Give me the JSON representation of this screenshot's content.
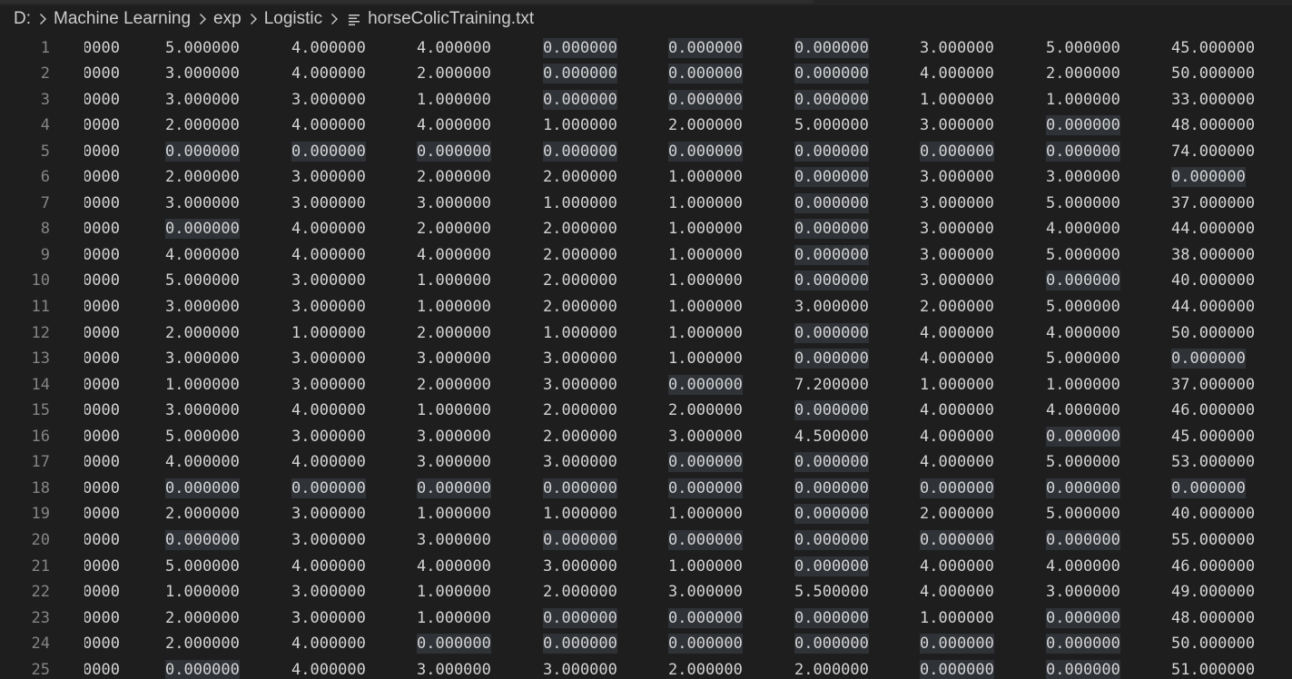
{
  "breadcrumb": {
    "items": [
      "D:",
      "Machine Learning",
      "exp",
      "Logistic"
    ],
    "file": "horseColicTraining.txt"
  },
  "editor": {
    "lines": [
      {
        "n": "1",
        "cells": [
          "0000",
          "5.000000",
          "4.000000",
          "4.000000",
          "0.000000",
          "0.000000",
          "0.000000",
          "3.000000",
          "5.000000",
          "45.000000"
        ]
      },
      {
        "n": "2",
        "cells": [
          "0000",
          "3.000000",
          "4.000000",
          "2.000000",
          "0.000000",
          "0.000000",
          "0.000000",
          "4.000000",
          "2.000000",
          "50.000000"
        ]
      },
      {
        "n": "3",
        "cells": [
          "0000",
          "3.000000",
          "3.000000",
          "1.000000",
          "0.000000",
          "0.000000",
          "0.000000",
          "1.000000",
          "1.000000",
          "33.000000"
        ]
      },
      {
        "n": "4",
        "cells": [
          "0000",
          "2.000000",
          "4.000000",
          "4.000000",
          "1.000000",
          "2.000000",
          "5.000000",
          "3.000000",
          "0.000000",
          "48.000000"
        ]
      },
      {
        "n": "5",
        "cells": [
          "0000",
          "0.000000",
          "0.000000",
          "0.000000",
          "0.000000",
          "0.000000",
          "0.000000",
          "0.000000",
          "0.000000",
          "74.000000"
        ]
      },
      {
        "n": "6",
        "cells": [
          "0000",
          "2.000000",
          "3.000000",
          "2.000000",
          "2.000000",
          "1.000000",
          "0.000000",
          "3.000000",
          "3.000000",
          "0.000000"
        ]
      },
      {
        "n": "7",
        "cells": [
          "0000",
          "3.000000",
          "3.000000",
          "3.000000",
          "1.000000",
          "1.000000",
          "0.000000",
          "3.000000",
          "5.000000",
          "37.000000"
        ]
      },
      {
        "n": "8",
        "cells": [
          "0000",
          "0.000000",
          "4.000000",
          "2.000000",
          "2.000000",
          "1.000000",
          "0.000000",
          "3.000000",
          "4.000000",
          "44.000000"
        ]
      },
      {
        "n": "9",
        "cells": [
          "0000",
          "4.000000",
          "4.000000",
          "4.000000",
          "2.000000",
          "1.000000",
          "0.000000",
          "3.000000",
          "5.000000",
          "38.000000"
        ]
      },
      {
        "n": "10",
        "cells": [
          "0000",
          "5.000000",
          "3.000000",
          "1.000000",
          "2.000000",
          "1.000000",
          "0.000000",
          "3.000000",
          "0.000000",
          "40.000000"
        ]
      },
      {
        "n": "11",
        "cells": [
          "0000",
          "3.000000",
          "3.000000",
          "1.000000",
          "2.000000",
          "1.000000",
          "3.000000",
          "2.000000",
          "5.000000",
          "44.000000"
        ]
      },
      {
        "n": "12",
        "cells": [
          "0000",
          "2.000000",
          "1.000000",
          "2.000000",
          "1.000000",
          "1.000000",
          "0.000000",
          "4.000000",
          "4.000000",
          "50.000000"
        ]
      },
      {
        "n": "13",
        "cells": [
          "0000",
          "3.000000",
          "3.000000",
          "3.000000",
          "3.000000",
          "1.000000",
          "0.000000",
          "4.000000",
          "5.000000",
          "0.000000"
        ]
      },
      {
        "n": "14",
        "cells": [
          "0000",
          "1.000000",
          "3.000000",
          "2.000000",
          "3.000000",
          "0.000000",
          "7.200000",
          "1.000000",
          "1.000000",
          "37.000000"
        ]
      },
      {
        "n": "15",
        "cells": [
          "0000",
          "3.000000",
          "4.000000",
          "1.000000",
          "2.000000",
          "2.000000",
          "0.000000",
          "4.000000",
          "4.000000",
          "46.000000"
        ]
      },
      {
        "n": "16",
        "cells": [
          "0000",
          "5.000000",
          "3.000000",
          "3.000000",
          "2.000000",
          "3.000000",
          "4.500000",
          "4.000000",
          "0.000000",
          "45.000000"
        ]
      },
      {
        "n": "17",
        "cells": [
          "0000",
          "4.000000",
          "4.000000",
          "3.000000",
          "3.000000",
          "0.000000",
          "0.000000",
          "4.000000",
          "5.000000",
          "53.000000"
        ]
      },
      {
        "n": "18",
        "cells": [
          "0000",
          "0.000000",
          "0.000000",
          "0.000000",
          "0.000000",
          "0.000000",
          "0.000000",
          "0.000000",
          "0.000000",
          "0.000000"
        ]
      },
      {
        "n": "19",
        "cells": [
          "0000",
          "2.000000",
          "3.000000",
          "1.000000",
          "1.000000",
          "1.000000",
          "0.000000",
          "2.000000",
          "5.000000",
          "40.000000"
        ]
      },
      {
        "n": "20",
        "cells": [
          "0000",
          "0.000000",
          "3.000000",
          "3.000000",
          "0.000000",
          "0.000000",
          "0.000000",
          "0.000000",
          "0.000000",
          "55.000000"
        ]
      },
      {
        "n": "21",
        "cells": [
          "0000",
          "5.000000",
          "4.000000",
          "4.000000",
          "3.000000",
          "1.000000",
          "0.000000",
          "4.000000",
          "4.000000",
          "46.000000"
        ]
      },
      {
        "n": "22",
        "cells": [
          "0000",
          "1.000000",
          "3.000000",
          "1.000000",
          "2.000000",
          "3.000000",
          "5.500000",
          "4.000000",
          "3.000000",
          "49.000000"
        ]
      },
      {
        "n": "23",
        "cells": [
          "0000",
          "2.000000",
          "3.000000",
          "1.000000",
          "0.000000",
          "0.000000",
          "0.000000",
          "1.000000",
          "0.000000",
          "48.000000"
        ]
      },
      {
        "n": "24",
        "cells": [
          "0000",
          "2.000000",
          "4.000000",
          "0.000000",
          "0.000000",
          "0.000000",
          "0.000000",
          "0.000000",
          "0.000000",
          "50.000000"
        ]
      },
      {
        "n": "25",
        "cells": [
          "0000",
          "0.000000",
          "4.000000",
          "3.000000",
          "3.000000",
          "2.000000",
          "2.000000",
          "0.000000",
          "0.000000",
          "51.000000"
        ]
      }
    ]
  }
}
